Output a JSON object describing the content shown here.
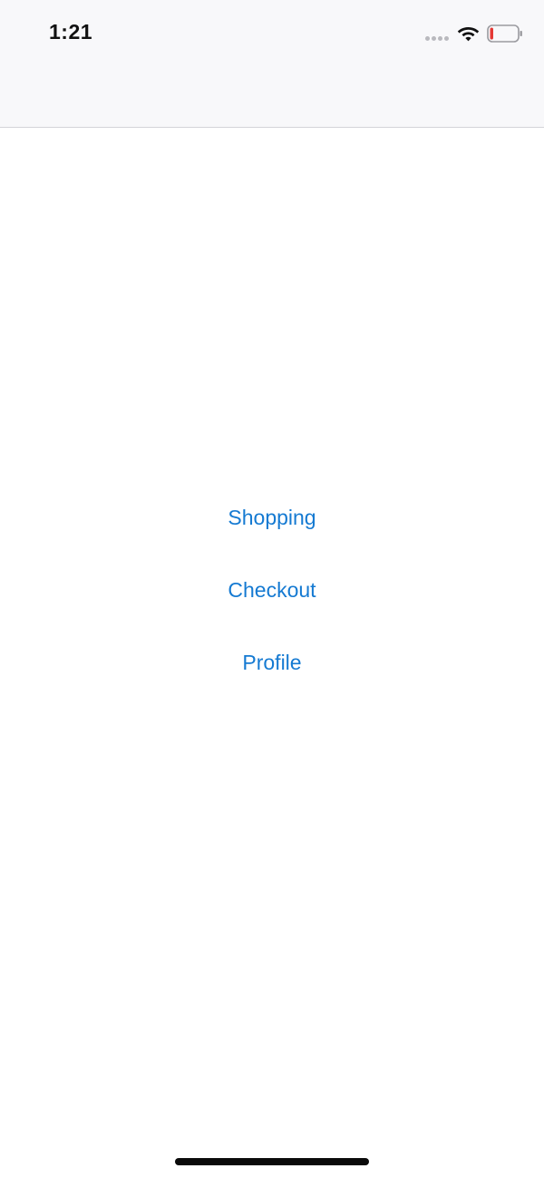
{
  "status_bar": {
    "time": "1:21",
    "signal_icon": "cellular-dots-icon",
    "wifi_icon": "wifi-icon",
    "battery_icon": "battery-low-icon",
    "battery_level": 0.12,
    "battery_color": "#e53935"
  },
  "menu": {
    "items": [
      {
        "label": "Shopping"
      },
      {
        "label": "Checkout"
      },
      {
        "label": "Profile"
      }
    ],
    "link_color": "#157ad2"
  },
  "colors": {
    "nav_background": "#f8f8fa",
    "page_background": "#ffffff"
  }
}
